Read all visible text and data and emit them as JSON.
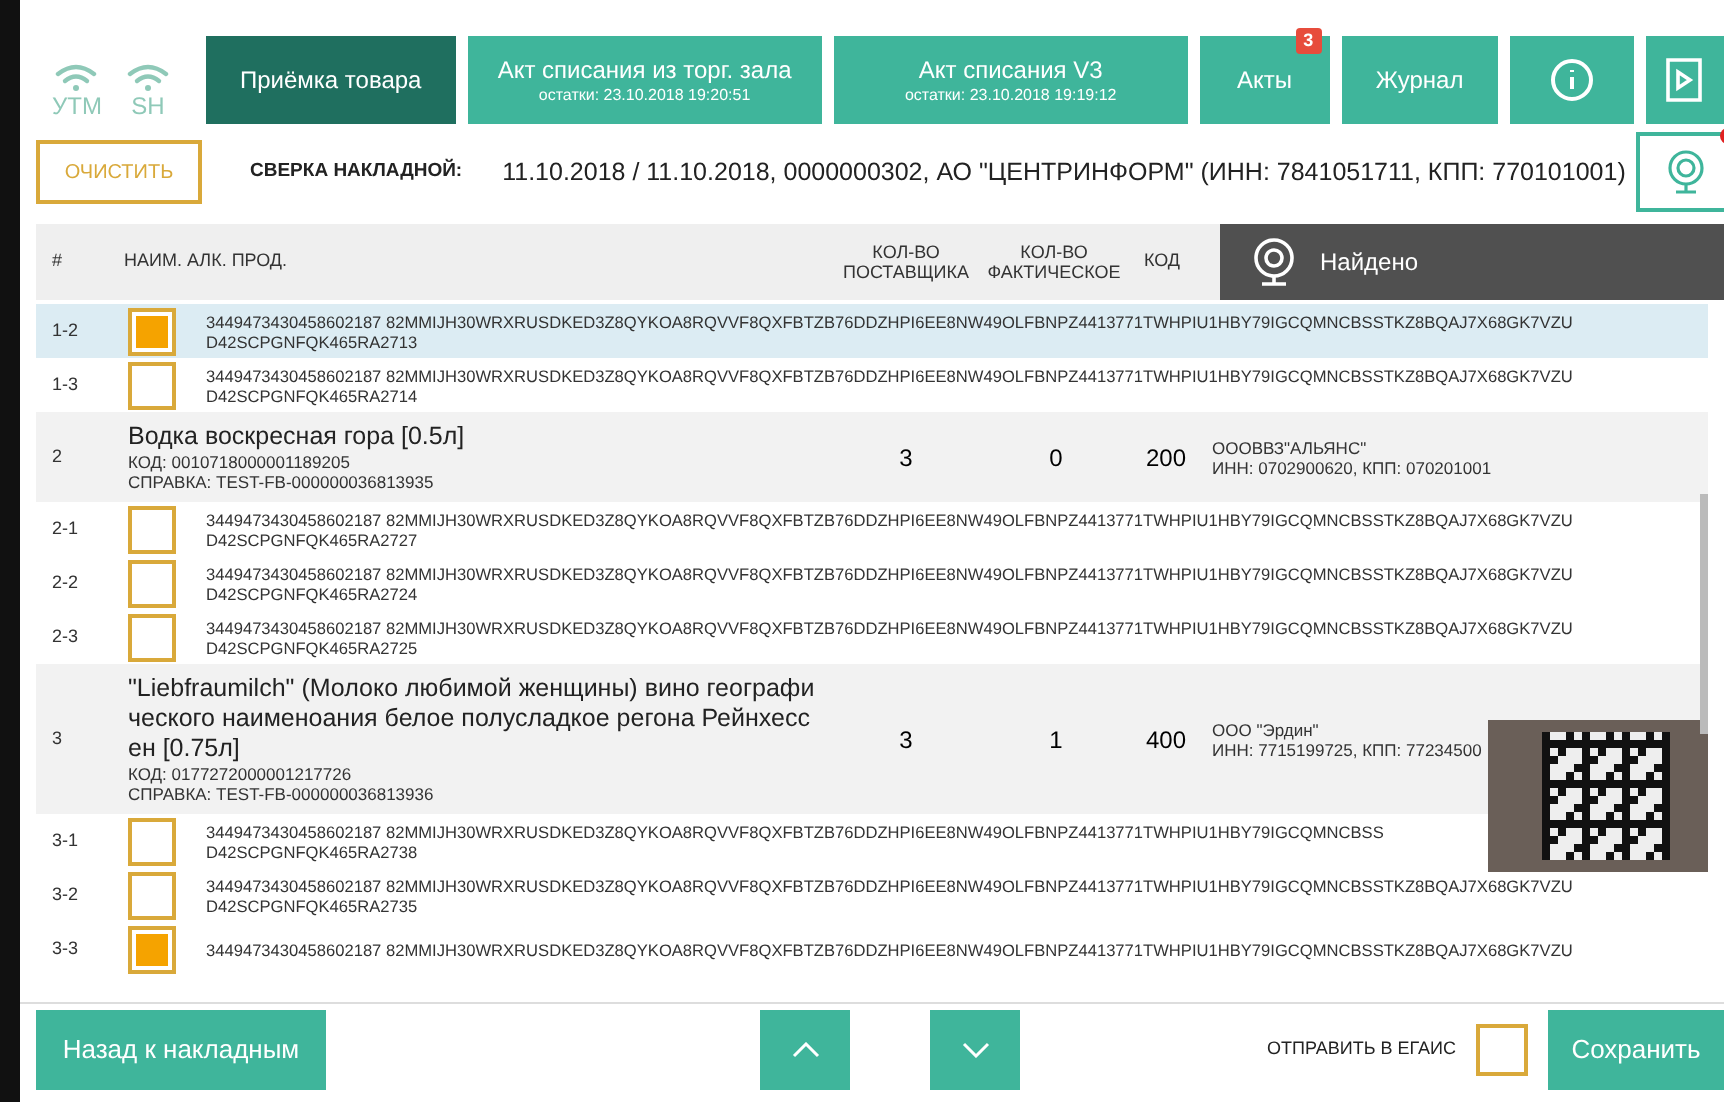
{
  "status_icons": [
    {
      "label": "УТМ"
    },
    {
      "label": "SH"
    }
  ],
  "tabs": [
    {
      "label": "Приёмка товара",
      "selected": true
    },
    {
      "label": "Акт списания из торг. зала",
      "sub": "остатки: 23.10.2018 19:20:51",
      "selected": false
    },
    {
      "label": "Акт списания V3",
      "sub": "остатки: 23.10.2018 19:19:12",
      "selected": false
    },
    {
      "label": "Акты",
      "badge": "3",
      "selected": false
    },
    {
      "label": "Журнал",
      "selected": false
    }
  ],
  "clear_button": "ОЧИСТИТЬ",
  "invoice": {
    "label": "СВЕРКА НАКЛАДНОЙ:",
    "value": "11.10.2018 / 11.10.2018, 0000000302, АО \"ЦЕНТРИНФОРМ\" (ИНН: 7841051711, КПП: 770101001)"
  },
  "camera": {
    "recording": true
  },
  "columns": [
    "#",
    "НАИМ. АЛК. ПРОД.",
    "КОЛ-ВО ПОСТАВЩИКА",
    "КОЛ-ВО ФАКТИЧЕСКОЕ",
    "КОД"
  ],
  "toast": "Найдено",
  "rows": [
    {
      "kind": "mark",
      "id": "1-2",
      "checked": true,
      "selected": true,
      "line1": "3449473430458602187 82MMIJH30WRXRUSDKED3Z8QYKOA8RQVVF8QXFBTZB76DDZHPI6EE8NW49OLFBNPZ4413771TWHPIU1HBY79IGCQMNCBSSTKZ8BQAJ7X68GK7VZU",
      "line2": "D42SCPGNFQK465RA2713"
    },
    {
      "kind": "mark",
      "id": "1-3",
      "checked": false,
      "selected": false,
      "line1": "3449473430458602187 82MMIJH30WRXRUSDKED3Z8QYKOA8RQVVF8QXFBTZB76DDZHPI6EE8NW49OLFBNPZ4413771TWHPIU1HBY79IGCQMNCBSSTKZ8BQAJ7X68GK7VZU",
      "line2": "D42SCPGNFQK465RA2714"
    },
    {
      "kind": "product",
      "id": "2",
      "name": "Водка воскресная гора  [0.5л]",
      "code": "КОД: 0010718000001189205",
      "ref": "СПРАВКА: TEST-FB-000000036813935",
      "qty_supplier": "3",
      "qty_actual": "0",
      "code_num": "200",
      "supplier": "ОООВВЗ\"АЛЬЯНС\"",
      "inn": "ИНН: 0702900620, КПП: 070201001"
    },
    {
      "kind": "mark",
      "id": "2-1",
      "checked": false,
      "selected": false,
      "line1": "3449473430458602187 82MMIJH30WRXRUSDKED3Z8QYKOA8RQVVF8QXFBTZB76DDZHPI6EE8NW49OLFBNPZ4413771TWHPIU1HBY79IGCQMNCBSSTKZ8BQAJ7X68GK7VZU",
      "line2": "D42SCPGNFQK465RA2727"
    },
    {
      "kind": "mark",
      "id": "2-2",
      "checked": false,
      "selected": false,
      "line1": "3449473430458602187 82MMIJH30WRXRUSDKED3Z8QYKOA8RQVVF8QXFBTZB76DDZHPI6EE8NW49OLFBNPZ4413771TWHPIU1HBY79IGCQMNCBSSTKZ8BQAJ7X68GK7VZU",
      "line2": "D42SCPGNFQK465RA2724"
    },
    {
      "kind": "mark",
      "id": "2-3",
      "checked": false,
      "selected": false,
      "line1": "3449473430458602187 82MMIJH30WRXRUSDKED3Z8QYKOA8RQVVF8QXFBTZB76DDZHPI6EE8NW49OLFBNPZ4413771TWHPIU1HBY79IGCQMNCBSSTKZ8BQAJ7X68GK7VZU",
      "line2": "D42SCPGNFQK465RA2725"
    },
    {
      "kind": "product",
      "id": "3",
      "name": "\"Liebfraumilch\" (Молоко любимой женщины) вино географи ческого наименоания белое полусладкое регона Рейнхесс ен  [0.75л]",
      "code": "КОД: 0177272000001217726",
      "ref": "СПРАВКА: TEST-FB-000000036813936",
      "qty_supplier": "3",
      "qty_actual": "1",
      "code_num": "400",
      "supplier": "ООО \"Эрдин\"",
      "inn": "ИНН: 7715199725, КПП: 77234500"
    },
    {
      "kind": "mark",
      "id": "3-1",
      "checked": false,
      "selected": false,
      "line1": "3449473430458602187 82MMIJH30WRXRUSDKED3Z8QYKOA8RQVVF8QXFBTZB76DDZHPI6EE8NW49OLFBNPZ4413771TWHPIU1HBY79IGCQMNCBSS",
      "line2": "D42SCPGNFQK465RA2738"
    },
    {
      "kind": "mark",
      "id": "3-2",
      "checked": false,
      "selected": false,
      "line1": "3449473430458602187 82MMIJH30WRXRUSDKED3Z8QYKOA8RQVVF8QXFBTZB76DDZHPI6EE8NW49OLFBNPZ4413771TWHPIU1HBY79IGCQMNCBSSTKZ8BQAJ7X68GK7VZU",
      "line2": "D42SCPGNFQK465RA2735"
    },
    {
      "kind": "mark",
      "id": "3-3",
      "checked": true,
      "selected": false,
      "line1": "3449473430458602187 82MMIJH30WRXRUSDKED3Z8QYKOA8RQVVF8QXFBTZB76DDZHPI6EE8NW49OLFBNPZ4413771TWHPIU1HBY79IGCQMNCBSSTKZ8BQAJ7X68GK7VZU"
    }
  ],
  "footer": {
    "back": "Назад к накладным",
    "send_label": "ОТПРАВИТЬ В ЕГАИС",
    "send_checked": false,
    "save": "Сохранить"
  }
}
